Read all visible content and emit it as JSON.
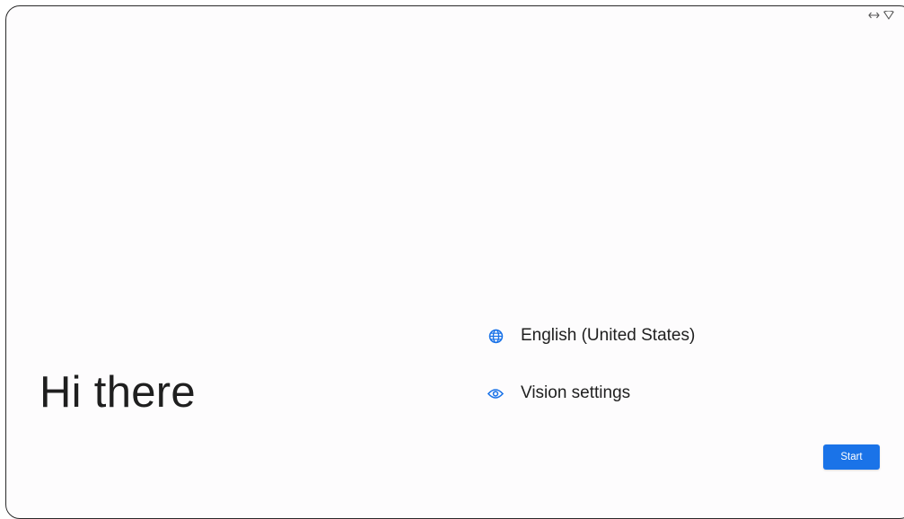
{
  "status_bar": {
    "icons": [
      "data-arrows-icon",
      "wifi-icon"
    ]
  },
  "welcome": {
    "greeting": "Hi there"
  },
  "options": {
    "language": {
      "label": "English (United States)",
      "icon": "globe-icon"
    },
    "vision": {
      "label": "Vision settings",
      "icon": "eye-icon"
    }
  },
  "actions": {
    "start_label": "Start"
  },
  "colors": {
    "accent": "#1a73e8",
    "text": "#1f1f1f",
    "background": "#fdfcfd"
  }
}
